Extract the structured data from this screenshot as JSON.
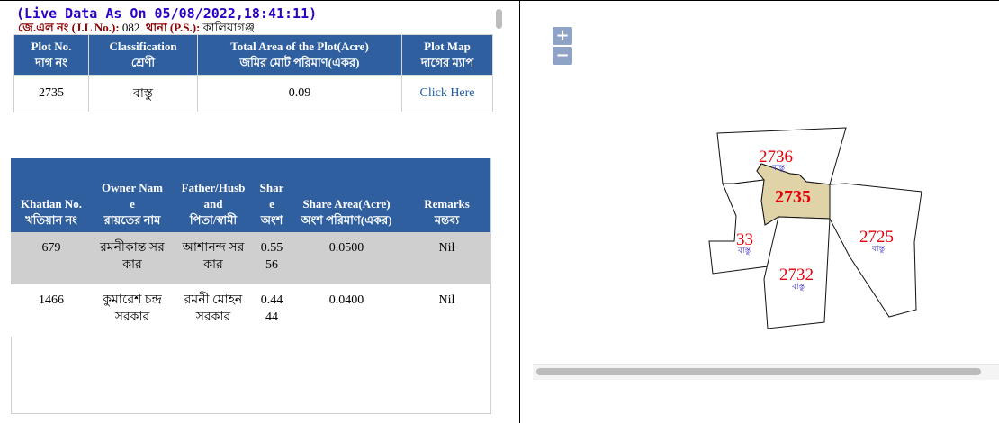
{
  "header": {
    "live_data": "(Live Data As On 05/08/2022,18:41:11)",
    "jl_label": "জে.এল নং (J.L No.):",
    "jl_value": "082",
    "ps_label": "থানা (P.S.):",
    "ps_value": "কালিয়াগঞ্জ"
  },
  "plot_table": {
    "headers": [
      {
        "en": "Plot No.",
        "bn": "দাগ নং"
      },
      {
        "en": "Classification",
        "bn": "শ্রেণী"
      },
      {
        "en": "Total Area of the Plot(Acre)",
        "bn": "জমির মোট পরিমাণ(একর)"
      },
      {
        "en": "Plot Map",
        "bn": "দাগের ম্যাপ"
      }
    ],
    "row": {
      "plot_no": "2735",
      "classification": "বাস্তু",
      "area": "0.09",
      "map_link": "Click Here"
    }
  },
  "owner_table": {
    "headers": [
      {
        "en": "Khatian No.",
        "bn": "খতিয়ান নং"
      },
      {
        "en1": "Owner Nam",
        "en2": "e",
        "bn": "রায়তের নাম"
      },
      {
        "en1": "Father/Husb",
        "en2": "and",
        "bn": "পিতা/স্বামী"
      },
      {
        "en1": "Shar",
        "en2": "e",
        "bn": "অংশ"
      },
      {
        "en": "Share Area(Acre)",
        "bn": "অংশ পরিমাণ(একর)"
      },
      {
        "en": "Remarks",
        "bn": "মন্তব্য"
      }
    ],
    "rows": [
      {
        "khatian": "679",
        "owner1": "রমনীকান্ত সর",
        "owner2": "কার",
        "father1": "আশানন্দ সর",
        "father2": "কার",
        "share1": "0.55",
        "share2": "56",
        "share_area": "0.0500",
        "remarks": "Nil"
      },
      {
        "khatian": "1466",
        "owner1": "কুমারেশ চন্দ্র",
        "owner2": "সরকার",
        "father1": "রমনী মোহন",
        "father2": "সরকার",
        "share1": "0.44",
        "share2": "44",
        "share_area": "0.0400",
        "remarks": "Nil"
      }
    ]
  },
  "map": {
    "zoom_in": "+",
    "zoom_out": "−",
    "plots": [
      {
        "number": "2736",
        "class": "বাস্তু"
      },
      {
        "number": "2735",
        "class": ""
      },
      {
        "number": "33",
        "class": "বাস্তু"
      },
      {
        "number": "2725",
        "class": "বাস্তু"
      },
      {
        "number": "2732",
        "class": "বাস্তু"
      }
    ],
    "highlight_color": "#e0d3a8",
    "label_color": "#e8000b",
    "class_color": "#3a2fd6"
  }
}
